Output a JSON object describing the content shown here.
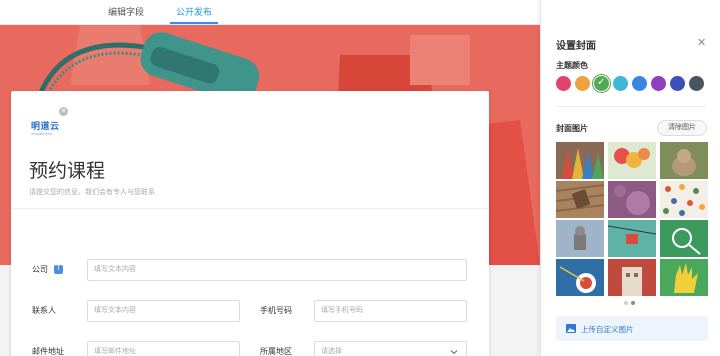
{
  "tabs": {
    "edit_fields": "编辑字段",
    "publish": "公开发布"
  },
  "form": {
    "logo_text": "明道云",
    "logo_sub": "mingdao.com",
    "title": "预约课程",
    "description": "请提交您的信息，我们会有专人与您联系",
    "fields": {
      "company": {
        "label": "公司",
        "badge": "T",
        "placeholder": "填写文本内容"
      },
      "contact": {
        "label": "联系人",
        "placeholder": "填写文本内容"
      },
      "phone": {
        "label": "手机号码",
        "placeholder": "填写手机号码"
      },
      "email": {
        "label": "邮件地址",
        "placeholder": "填写邮件地址"
      },
      "region": {
        "label": "所属地区",
        "placeholder": "请选择"
      }
    }
  },
  "panel": {
    "title": "设置封面",
    "close_icon": "close-icon",
    "theme_color_label": "主题颜色",
    "theme_colors": [
      "#e0456f",
      "#f0a13e",
      "#54a954",
      "#3fb8d8",
      "#3b86e0",
      "#8c3fbf",
      "#3d4fb8",
      "#4a5560"
    ],
    "selected_color_index": 2,
    "cover_label": "封面图片",
    "clear_button": "清除图片",
    "upload_button": "上传自定义图片",
    "upload_icon": "image-icon",
    "page_indicator": {
      "current": 2,
      "total": 2
    }
  }
}
